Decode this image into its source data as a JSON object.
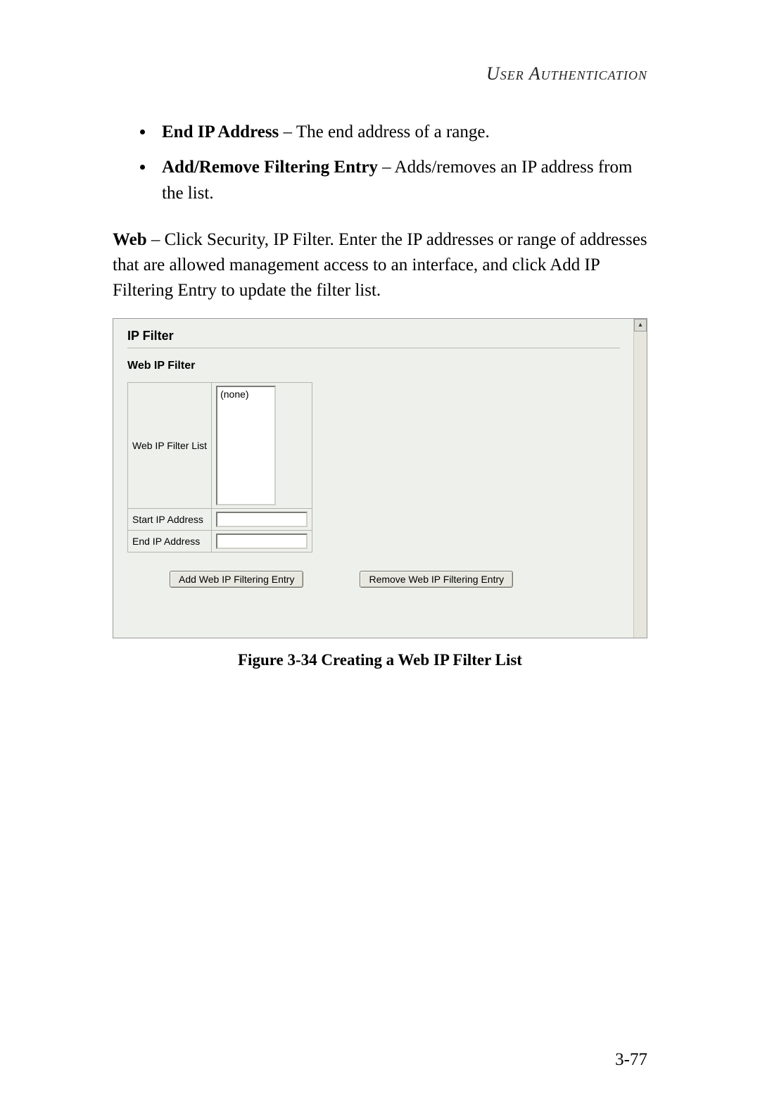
{
  "header": {
    "running_head": "User Authentication"
  },
  "bullets": [
    {
      "term": "End IP Address",
      "desc": " – The end address of a range."
    },
    {
      "term": "Add/Remove Filtering Entry",
      "desc": " – Adds/removes an IP address from the list."
    }
  ],
  "web_para": {
    "lead": "Web",
    "rest": " – Click Security, IP Filter. Enter the IP addresses or range of addresses that are allowed management access to an interface, and click Add IP Filtering Entry to update the filter list."
  },
  "panel": {
    "title": "IP Filter",
    "section": "Web IP Filter",
    "rows": {
      "list_label": "Web IP Filter List",
      "list_value": "(none)",
      "start_label": "Start IP Address",
      "start_value": "",
      "end_label": "End IP Address",
      "end_value": ""
    },
    "buttons": {
      "add": "Add Web IP Filtering Entry",
      "remove": "Remove Web IP Filtering Entry"
    }
  },
  "figure_caption": "Figure 3-34  Creating a Web IP Filter List",
  "page_number": "3-77"
}
